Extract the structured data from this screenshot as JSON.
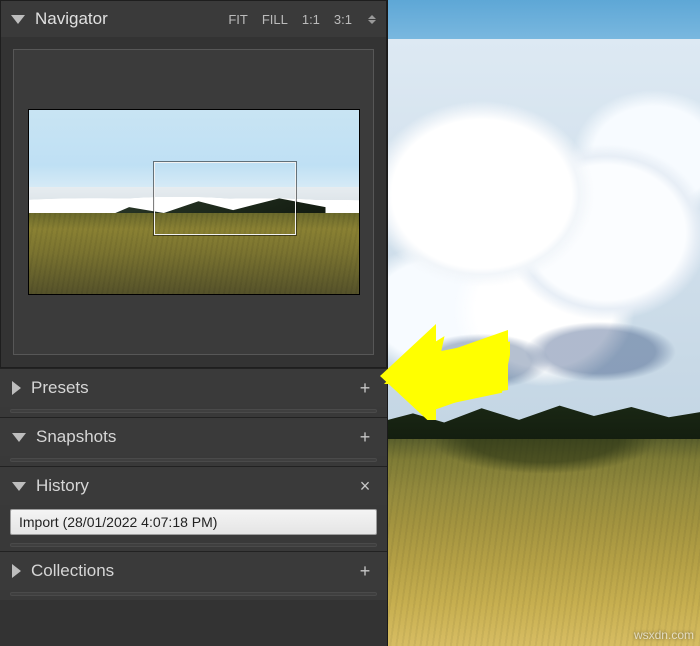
{
  "navigator": {
    "title": "Navigator",
    "zoom": {
      "fit": "FIT",
      "fill": "FILL",
      "one": "1:1",
      "three": "3:1"
    }
  },
  "panels": {
    "presets": {
      "label": "Presets",
      "action_glyph": "+"
    },
    "snapshots": {
      "label": "Snapshots",
      "action_glyph": "+"
    },
    "history": {
      "label": "History",
      "action_glyph": "×"
    },
    "collections": {
      "label": "Collections",
      "action_glyph": "+"
    }
  },
  "history": {
    "items": [
      {
        "label": "Import (28/01/2022 4:07:18 PM)"
      }
    ]
  },
  "watermark": "wsxdn.com"
}
